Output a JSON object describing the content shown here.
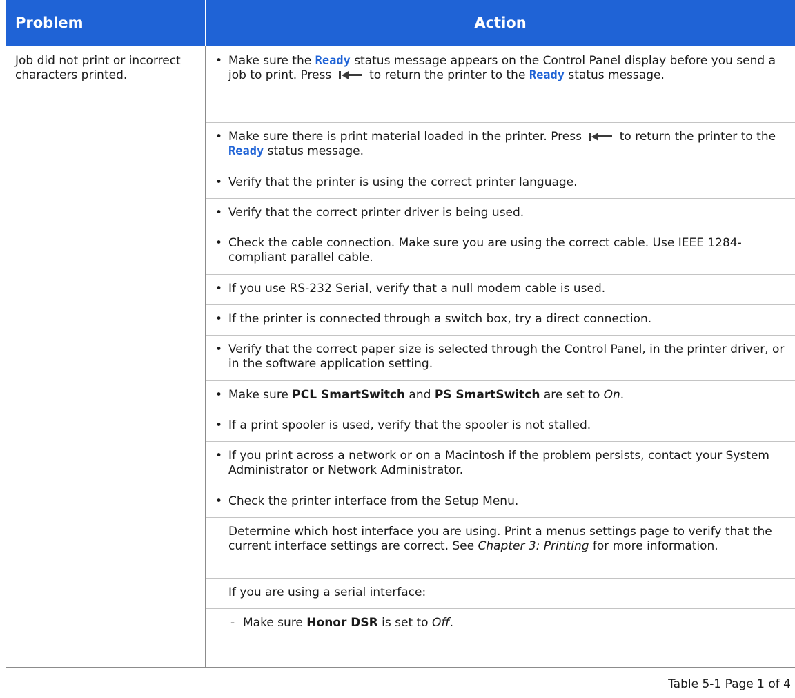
{
  "header": {
    "problem": "Problem",
    "action": "Action"
  },
  "problem": "Job did not print or incorrect characters printed.",
  "status_ready": "Ready",
  "rows": [
    {
      "pre": "Make sure the ",
      "mid": " status message appears on the Control Panel display before you send a job to print. Press ",
      "mid2": " to return the printer to the ",
      "post": " status message."
    },
    {
      "pre": "Make sure there is print material loaded in the printer. Press ",
      "mid": " to return the printer to the ",
      "post": " status message."
    },
    {
      "text": "Verify that the printer is using the correct printer language."
    },
    {
      "text": "Verify that the correct printer driver is being used."
    },
    {
      "text": "Check the cable connection. Make sure you are using the correct cable. Use IEEE 1284-compliant parallel cable."
    },
    {
      "text": "If you use RS-232 Serial, verify that a null modem cable is used."
    },
    {
      "text": "If the printer is connected through a switch box, try a direct connection."
    },
    {
      "text": "Verify that the correct paper size is selected through the Control Panel, in the printer driver, or in the software application setting."
    },
    {
      "pre": "Make sure ",
      "b1": "PCL SmartSwitch",
      "mid": " and ",
      "b2": "PS SmartSwitch",
      "post": " are set to ",
      "i": "On",
      "end": "."
    },
    {
      "text": "If a print spooler is used, verify that the spooler is not stalled."
    },
    {
      "text": "If you print across a network or on a Macintosh if the problem persists, contact your System Administrator or Network Administrator."
    },
    {
      "text": "Check the printer interface from the Setup Menu."
    }
  ],
  "para1": {
    "pre": "Determine which host interface you are using. Print a menus settings page to verify that the current interface settings are correct. See ",
    "i": "Chapter 3: Printing",
    "post": " for more information."
  },
  "para2": "If you are using a serial interface:",
  "dash_item": {
    "dash": "-",
    "pre": "Make sure ",
    "b": "Honor DSR",
    "mid": " is set to ",
    "i": "Off",
    "end": "."
  },
  "bullet": "•",
  "footer": "Table 5-1  Page 1 of 4",
  "icons": {
    "back": "back-arrow-icon"
  },
  "colors": {
    "header_bg": "#1f63d6",
    "code": "#1f63d6"
  }
}
